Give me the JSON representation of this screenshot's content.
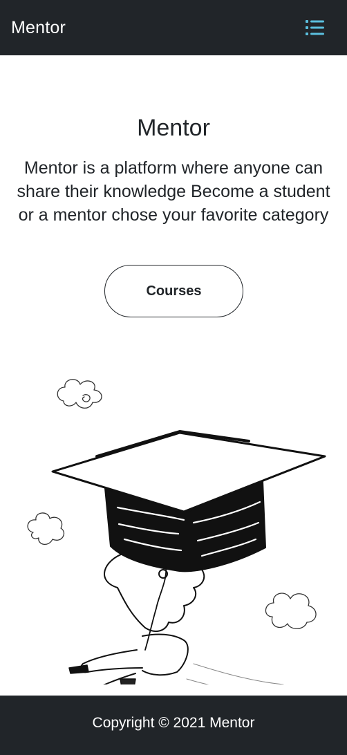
{
  "navbar": {
    "brand": "Mentor",
    "menu_icon": "list-icon",
    "menu_icon_color": "#5bc0de"
  },
  "hero": {
    "title": "Mentor",
    "description": "Mentor is a platform where anyone can share their knowledge Become a student or a mentor chose your favorite category",
    "courses_button": "Courses"
  },
  "illustration": {
    "name": "graduation-cap-parachute-illustration"
  },
  "footer": {
    "copyright": "Copyright © 2021 Mentor"
  },
  "colors": {
    "dark": "#212529",
    "background": "#ffffff",
    "accent": "#5bc0de"
  }
}
